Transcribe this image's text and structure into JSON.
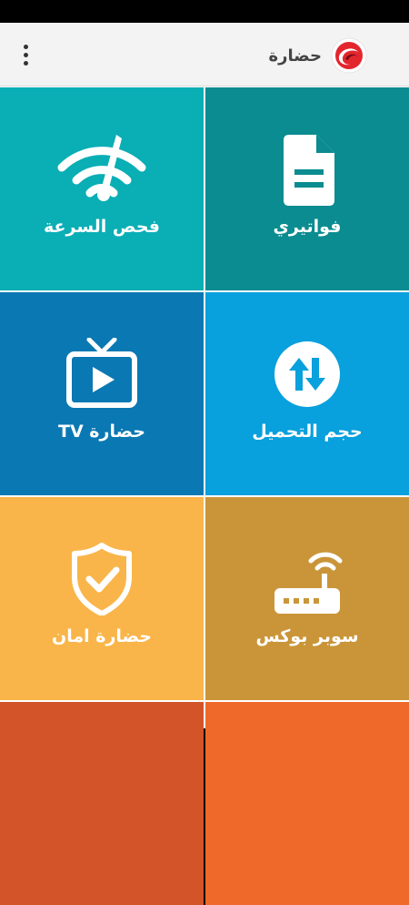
{
  "status_bar": {},
  "app_bar": {
    "brand_name": "حضارة",
    "menu_icon": "more-vert-icon",
    "logo_icon": "hadara-logo-icon"
  },
  "colors": {
    "speed_test": "#0AAEB5",
    "bills": "#0A8C90",
    "tv": "#0A78B3",
    "download": "#08A0DD",
    "security": "#F9B54A",
    "super_box": "#CA9539",
    "bottom_left": "#D4542A",
    "bottom_right": "#EF6A2A"
  },
  "tiles": [
    {
      "label": "فحص السرعة",
      "icon": "speedometer-wifi-icon"
    },
    {
      "label": "فواتيري",
      "icon": "document-icon"
    },
    {
      "label": "حضارة TV",
      "icon": "tv-play-icon"
    },
    {
      "label": "حجم التحميل",
      "icon": "up-down-arrows-icon"
    },
    {
      "label": "حضارة امان",
      "icon": "shield-check-icon"
    },
    {
      "label": "سوبر بوكس",
      "icon": "router-icon"
    }
  ]
}
